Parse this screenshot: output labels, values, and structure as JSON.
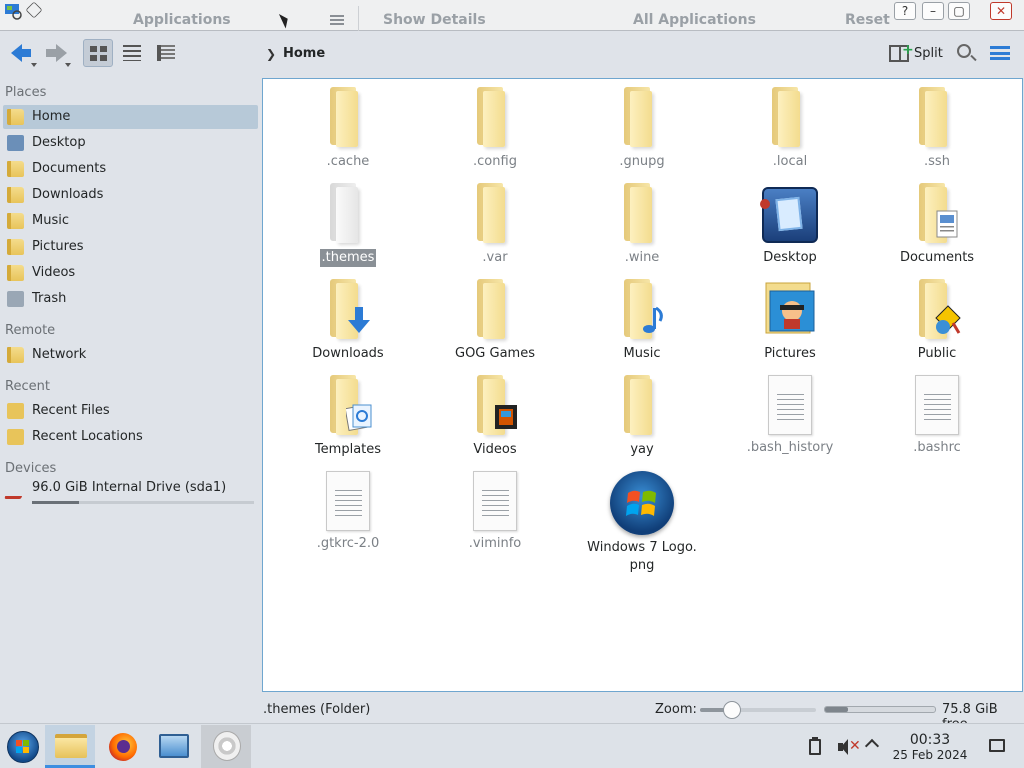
{
  "titlebar": {
    "applications": "Applications",
    "show_details": "Show Details",
    "all_applications": "All Applications",
    "reset": "Reset",
    "help_glyph": "?"
  },
  "breadcrumb": {
    "current": "Home"
  },
  "toolbar": {
    "split_label": "Split"
  },
  "sidebar": {
    "places": {
      "heading": "Places",
      "items": [
        {
          "label": "Home",
          "icon": "home-folder-icon",
          "selected": true
        },
        {
          "label": "Desktop",
          "icon": "desktop-icon"
        },
        {
          "label": "Documents",
          "icon": "documents-folder-icon"
        },
        {
          "label": "Downloads",
          "icon": "downloads-folder-icon"
        },
        {
          "label": "Music",
          "icon": "music-folder-icon"
        },
        {
          "label": "Pictures",
          "icon": "pictures-folder-icon"
        },
        {
          "label": "Videos",
          "icon": "videos-folder-icon"
        },
        {
          "label": "Trash",
          "icon": "trash-icon"
        }
      ]
    },
    "remote": {
      "heading": "Remote",
      "items": [
        {
          "label": "Network",
          "icon": "network-folder-icon"
        }
      ]
    },
    "recent": {
      "heading": "Recent",
      "items": [
        {
          "label": "Recent Files",
          "icon": "recent-files-icon"
        },
        {
          "label": "Recent Locations",
          "icon": "recent-locations-icon"
        }
      ]
    },
    "devices": {
      "heading": "Devices",
      "items": [
        {
          "label": "96.0 GiB Internal Drive (sda1)",
          "icon": "hard-drive-icon",
          "usage_fraction": 0.21
        }
      ]
    }
  },
  "files": [
    {
      "name": ".cache",
      "kind": "folder",
      "hidden": true
    },
    {
      "name": ".config",
      "kind": "folder",
      "hidden": true
    },
    {
      "name": ".gnupg",
      "kind": "folder",
      "hidden": true
    },
    {
      "name": ".local",
      "kind": "folder",
      "hidden": true
    },
    {
      "name": ".ssh",
      "kind": "folder",
      "hidden": true
    },
    {
      "name": ".themes",
      "kind": "folder",
      "hidden": true,
      "selected": true
    },
    {
      "name": ".var",
      "kind": "folder",
      "hidden": true
    },
    {
      "name": ".wine",
      "kind": "folder",
      "hidden": true
    },
    {
      "name": "Desktop",
      "kind": "desktop"
    },
    {
      "name": "Documents",
      "kind": "folder",
      "emblem": "documents"
    },
    {
      "name": "Downloads",
      "kind": "folder",
      "emblem": "downloads"
    },
    {
      "name": "GOG Games",
      "kind": "folder"
    },
    {
      "name": "Music",
      "kind": "folder",
      "emblem": "music"
    },
    {
      "name": "Pictures",
      "kind": "pictures"
    },
    {
      "name": "Public",
      "kind": "folder",
      "emblem": "public"
    },
    {
      "name": "Templates",
      "kind": "folder",
      "emblem": "templates"
    },
    {
      "name": "Videos",
      "kind": "folder",
      "emblem": "videos"
    },
    {
      "name": "yay",
      "kind": "folder"
    },
    {
      "name": ".bash_history",
      "kind": "doc",
      "hidden": true
    },
    {
      "name": ".bashrc",
      "kind": "doc",
      "hidden": true
    },
    {
      "name": ".gtkrc-2.0",
      "kind": "doc",
      "hidden": true
    },
    {
      "name": ".viminfo",
      "kind": "doc",
      "hidden": true
    },
    {
      "name": "Windows 7 Logo.\npng",
      "kind": "image"
    }
  ],
  "statusbar": {
    "selection": ".themes (Folder)",
    "zoom_label": "Zoom:",
    "zoom_fraction": 0.28,
    "disk_used_fraction": 0.21,
    "free_space": "75.8 GiB free"
  },
  "taskbar": {
    "apps": [
      {
        "name": "start-menu"
      },
      {
        "name": "file-manager",
        "active": true
      },
      {
        "name": "firefox"
      },
      {
        "name": "remote-desktop"
      },
      {
        "name": "terminal-sound"
      }
    ],
    "clock": {
      "time": "00:33",
      "date": "25 Feb 2024"
    }
  },
  "colors": {
    "accent": "#2c7bd5",
    "selection": "#b7c9d8",
    "panel_border": "#6fa6cf"
  }
}
